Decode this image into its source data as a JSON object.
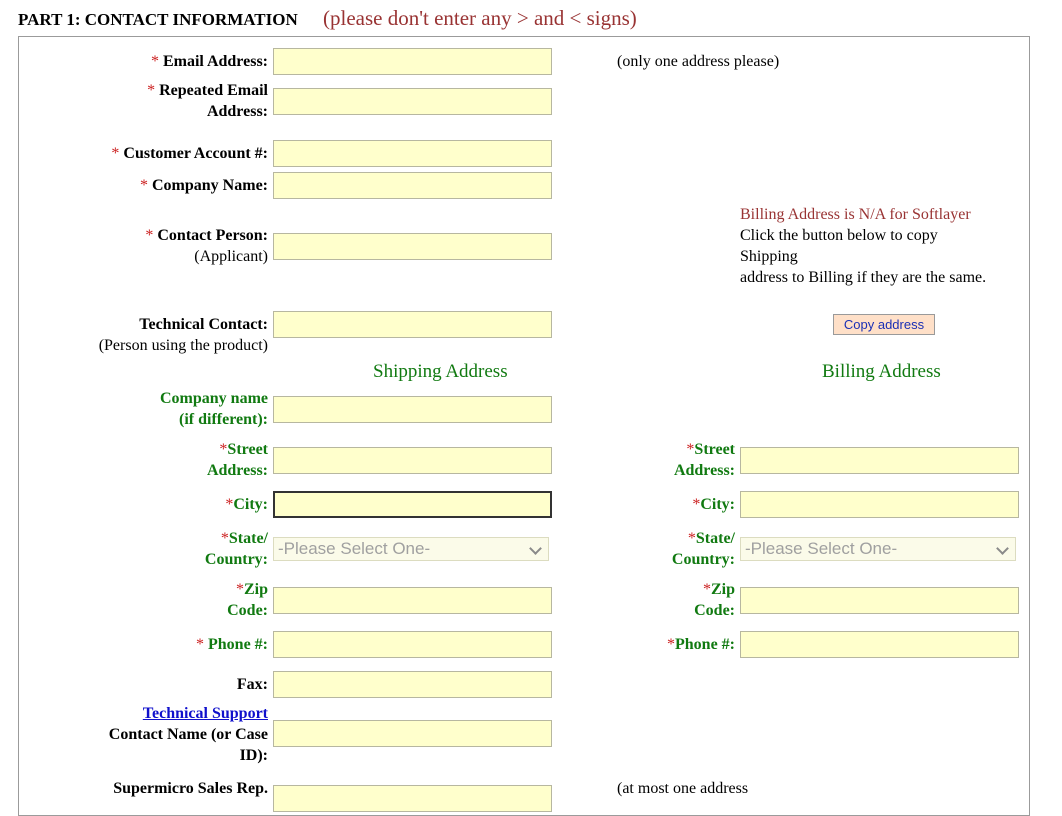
{
  "header": {
    "title": "PART 1: CONTACT INFORMATION",
    "note": "(please don't enter any  > and < signs)"
  },
  "star": "*",
  "fields": {
    "email": {
      "label": "Email Address:",
      "hint": "(only one address please)",
      "value": ""
    },
    "email_repeat": {
      "label_line1": "Repeated Email",
      "label_line2": "Address:",
      "value": ""
    },
    "account": {
      "label": "Customer Account #:",
      "value": ""
    },
    "company": {
      "label": "Company Name:",
      "value": ""
    },
    "contact": {
      "label": "Contact Person:",
      "sub": "(Applicant)",
      "value": ""
    },
    "tech_contact": {
      "label": "Technical Contact:",
      "sub": "(Person using the product)",
      "value": ""
    }
  },
  "billing_note": {
    "line1": "Billing Address is N/A for Softlayer",
    "line2": "Click the button below to copy",
    "line3": "Shipping",
    "line4": "address to Billing if they are the same.",
    "copy_button": "Copy address"
  },
  "shipping": {
    "heading": "Shipping Address",
    "company_line1": "Company name",
    "company_line2": "(if different):",
    "street_line1": "Street",
    "street_line2": "Address:",
    "city": "City:",
    "state_line1": "State/",
    "state_line2": "Country:",
    "state_selected": "-Please Select One-",
    "zip_line1": "Zip",
    "zip_line2": "Code:",
    "phone": "Phone #:",
    "fax": "Fax:"
  },
  "billing": {
    "heading": "Billing Address",
    "street_line1": "Street",
    "street_line2": "Address:",
    "city": "City:",
    "state_line1": "State/",
    "state_line2": "Country:",
    "state_selected": "-Please Select One-",
    "zip_line1": "Zip",
    "zip_line2": "Code:",
    "phone": "Phone #:"
  },
  "support": {
    "link": "Technical Support",
    "line2": "Contact Name (or Case",
    "line3": "ID):"
  },
  "sales": {
    "label": "Supermicro Sales Rep.",
    "hint": "(at most one address"
  }
}
